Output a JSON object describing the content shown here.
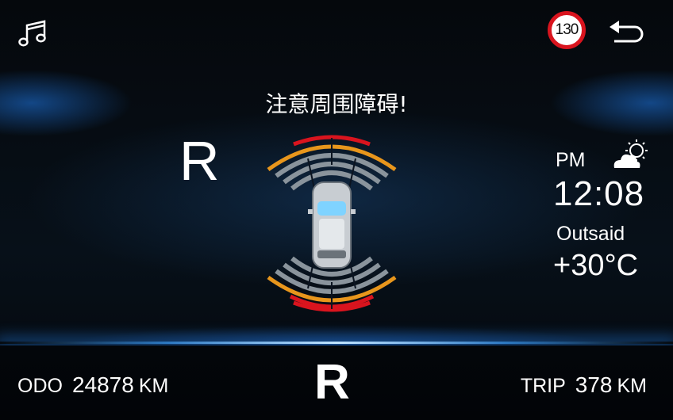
{
  "header": {
    "music_icon": "music-note-icon",
    "speed_limit": "130",
    "back_icon": "back-arrow-icon"
  },
  "parking": {
    "warning": "注意周围障碍!",
    "gear": "R",
    "colors": {
      "near": "#d9141e",
      "mid": "#e8961c",
      "far": "#8a949c"
    }
  },
  "status": {
    "ampm": "PM",
    "time": "12:08",
    "outside_label": "Outsaid",
    "outside_temp": "+30°C",
    "weather_icon": "partly-cloudy-icon"
  },
  "footer": {
    "odo_label": "ODO",
    "odo_value": "24878",
    "odo_unit": "KM",
    "gear": "R",
    "trip_label": "TRIP",
    "trip_value": "378",
    "trip_unit": "KM"
  }
}
